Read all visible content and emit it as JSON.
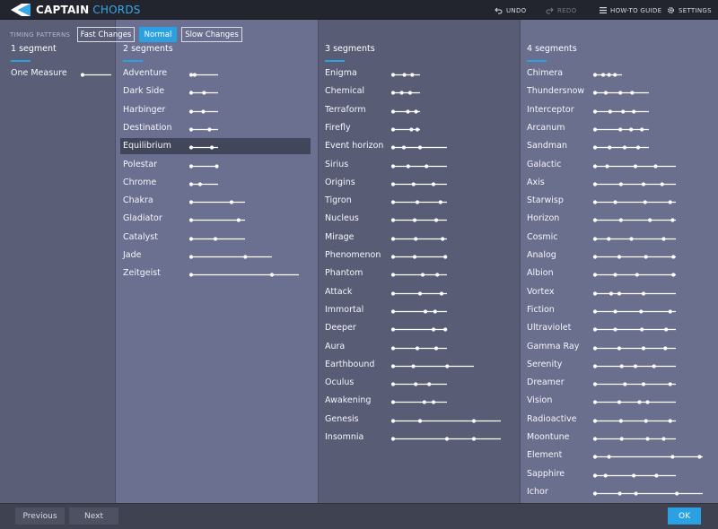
{
  "app": {
    "name_part1": "CAPTAIN",
    "name_part2": "CHORDS"
  },
  "toolbar": {
    "undo": "UNDO",
    "redo": "REDO",
    "guide": "HOW-TO GUIDE",
    "settings": "SETTINGS"
  },
  "timing": {
    "label": "TIMING PATTERNS",
    "options": [
      "Fast Changes",
      "Normal",
      "Slow Changes"
    ],
    "selected": "Normal"
  },
  "columns": [
    {
      "title": "1 segment",
      "patterns": [
        {
          "name": "One Measure",
          "dots": [
            0
          ],
          "end": 1,
          "selected": false
        }
      ]
    },
    {
      "title": "2 segments",
      "patterns": [
        {
          "name": "Adventure",
          "dots": [
            0,
            0.13
          ],
          "end": 1,
          "selected": false
        },
        {
          "name": "Dark Side",
          "dots": [
            0,
            0.48
          ],
          "end": 1,
          "selected": false
        },
        {
          "name": "Harbinger",
          "dots": [
            0,
            0.45
          ],
          "end": 1,
          "selected": false
        },
        {
          "name": "Destination",
          "dots": [
            0,
            0.68
          ],
          "end": 1,
          "selected": false
        },
        {
          "name": "Equilibrium",
          "dots": [
            0,
            0.77
          ],
          "end": 1,
          "selected": true
        },
        {
          "name": "Polestar",
          "dots": [
            0,
            0.95
          ],
          "end": 1,
          "selected": false
        },
        {
          "name": "Chrome",
          "dots": [
            0,
            0.33
          ],
          "end": 0.5,
          "selected": false
        },
        {
          "name": "Chakra",
          "dots": [
            0,
            0.75
          ],
          "end": 1,
          "selected": false
        },
        {
          "name": "Gladiator",
          "dots": [
            0,
            0.88
          ],
          "end": 1,
          "selected": false
        },
        {
          "name": "Catalyst",
          "dots": [
            0,
            0.45
          ],
          "end": 1,
          "selected": false
        },
        {
          "name": "Jade",
          "dots": [
            0,
            0.67
          ],
          "end": 1,
          "selected": false
        },
        {
          "name": "Zeitgeist",
          "dots": [
            0,
            0.75
          ],
          "end": 1,
          "selected": false
        }
      ]
    },
    {
      "title": "3 segments",
      "patterns": [
        {
          "name": "Enigma",
          "dots": [
            0,
            0.42,
            0.71
          ],
          "end": 1,
          "selected": false
        },
        {
          "name": "Chemical",
          "dots": [
            0,
            0.32,
            0.63
          ],
          "end": 1,
          "selected": false
        },
        {
          "name": "Terraform",
          "dots": [
            0,
            0.55,
            0.85
          ],
          "end": 1,
          "selected": false
        },
        {
          "name": "Firefly",
          "dots": [
            0,
            0.68,
            0.9
          ],
          "end": 1,
          "selected": false
        },
        {
          "name": "Event horizon",
          "dots": [
            0,
            0.2,
            0.5
          ],
          "end": 1,
          "selected": false
        },
        {
          "name": "Sirius",
          "dots": [
            0,
            0.28,
            0.62
          ],
          "end": 1,
          "selected": false
        },
        {
          "name": "Origins",
          "dots": [
            0,
            0.38,
            0.75
          ],
          "end": 1,
          "selected": false
        },
        {
          "name": "Tigron",
          "dots": [
            0,
            0.45,
            0.88
          ],
          "end": 1,
          "selected": false
        },
        {
          "name": "Nucleus",
          "dots": [
            0,
            0.4,
            0.8
          ],
          "end": 1,
          "selected": false
        },
        {
          "name": "Mirage",
          "dots": [
            0,
            0.42,
            0.92
          ],
          "end": 1,
          "selected": false
        },
        {
          "name": "Phenomenon",
          "dots": [
            0,
            0.4,
            0.97
          ],
          "end": 1,
          "selected": false
        },
        {
          "name": "Phantom",
          "dots": [
            0,
            0.55,
            0.82
          ],
          "end": 1,
          "selected": false
        },
        {
          "name": "Attack",
          "dots": [
            0,
            0.5,
            0.9
          ],
          "end": 1,
          "selected": false
        },
        {
          "name": "Immortal",
          "dots": [
            0,
            0.6,
            0.78
          ],
          "end": 1,
          "selected": false
        },
        {
          "name": "Deeper",
          "dots": [
            0,
            0.75,
            0.97
          ],
          "end": 1,
          "selected": false
        },
        {
          "name": "Aura",
          "dots": [
            0,
            0.45,
            0.8
          ],
          "end": 1,
          "selected": false
        },
        {
          "name": "Earthbound",
          "dots": [
            0,
            0.25,
            0.67
          ],
          "end": 1,
          "selected": false
        },
        {
          "name": "Oculus",
          "dots": [
            0,
            0.42,
            0.67
          ],
          "end": 1,
          "selected": false
        },
        {
          "name": "Awakening",
          "dots": [
            0,
            0.58,
            0.75
          ],
          "end": 1,
          "selected": false
        },
        {
          "name": "Genesis",
          "dots": [
            0,
            0.25,
            0.75
          ],
          "end": 1,
          "selected": false
        },
        {
          "name": "Insomnia",
          "dots": [
            0,
            0.5,
            0.75
          ],
          "end": 1,
          "selected": false
        }
      ]
    },
    {
      "title": "4 segments",
      "patterns": [
        {
          "name": "Chimera",
          "dots": [
            0,
            0.3,
            0.52,
            0.74
          ],
          "end": 1,
          "selected": false
        },
        {
          "name": "Thundersnow",
          "dots": [
            0,
            0.2,
            0.47,
            0.69
          ],
          "end": 1,
          "selected": false
        },
        {
          "name": "Interceptor",
          "dots": [
            0,
            0.28,
            0.52,
            0.72
          ],
          "end": 1,
          "selected": false
        },
        {
          "name": "Arcanum",
          "dots": [
            0,
            0.47,
            0.67,
            0.87
          ],
          "end": 1,
          "selected": false
        },
        {
          "name": "Sandman",
          "dots": [
            0,
            0.27,
            0.55,
            0.8
          ],
          "end": 1,
          "selected": false
        },
        {
          "name": "Galactic",
          "dots": [
            0,
            0.15,
            0.5,
            0.75
          ],
          "end": 1,
          "selected": false
        },
        {
          "name": "Axis",
          "dots": [
            0,
            0.32,
            0.6,
            0.83
          ],
          "end": 1,
          "selected": false
        },
        {
          "name": "Starwisp",
          "dots": [
            0,
            0.25,
            0.62,
            0.93
          ],
          "end": 1,
          "selected": false
        },
        {
          "name": "Horizon",
          "dots": [
            0,
            0.32,
            0.68,
            0.96
          ],
          "end": 1,
          "selected": false
        },
        {
          "name": "Cosmic",
          "dots": [
            0,
            0.17,
            0.45,
            0.85
          ],
          "end": 1,
          "selected": false
        },
        {
          "name": "Analog",
          "dots": [
            0,
            0.3,
            0.63,
            0.97
          ],
          "end": 1,
          "selected": false
        },
        {
          "name": "Albion",
          "dots": [
            0,
            0.25,
            0.52,
            0.97
          ],
          "end": 1,
          "selected": false
        },
        {
          "name": "Vortex",
          "dots": [
            0,
            0.2,
            0.3,
            0.6
          ],
          "end": 1,
          "selected": false
        },
        {
          "name": "Fiction",
          "dots": [
            0,
            0.25,
            0.57,
            0.93
          ],
          "end": 1,
          "selected": false
        },
        {
          "name": "Ultraviolet",
          "dots": [
            0,
            0.25,
            0.58,
            0.88
          ],
          "end": 1,
          "selected": false
        },
        {
          "name": "Gamma Ray",
          "dots": [
            0,
            0.3,
            0.6,
            0.87
          ],
          "end": 1,
          "selected": false
        },
        {
          "name": "Serenity",
          "dots": [
            0,
            0.33,
            0.5,
            0.73
          ],
          "end": 1,
          "selected": false
        },
        {
          "name": "Dreamer",
          "dots": [
            0,
            0.37,
            0.6,
            0.93
          ],
          "end": 1,
          "selected": false
        },
        {
          "name": "Vision",
          "dots": [
            0,
            0.3,
            0.55,
            0.65
          ],
          "end": 1,
          "selected": false
        },
        {
          "name": "Radioactive",
          "dots": [
            0,
            0.32,
            0.63,
            0.93
          ],
          "end": 1,
          "selected": false
        },
        {
          "name": "Moontune",
          "dots": [
            0,
            0.33,
            0.65,
            0.85
          ],
          "end": 1,
          "selected": false
        },
        {
          "name": "Element",
          "dots": [
            0,
            0.13,
            0.72,
            0.97
          ],
          "end": 1,
          "selected": false
        },
        {
          "name": "Sapphire",
          "dots": [
            0,
            0.13,
            0.48,
            0.76
          ],
          "end": 1,
          "selected": false
        },
        {
          "name": "Ichor",
          "dots": [
            0,
            0.23,
            0.38,
            0.76
          ],
          "end": 1,
          "selected": false
        }
      ]
    }
  ],
  "footer": {
    "previous": "Previous",
    "next": "Next",
    "ok": "OK"
  },
  "colors": {
    "accent": "#2aa1e3",
    "selected_row": "#42465b"
  }
}
